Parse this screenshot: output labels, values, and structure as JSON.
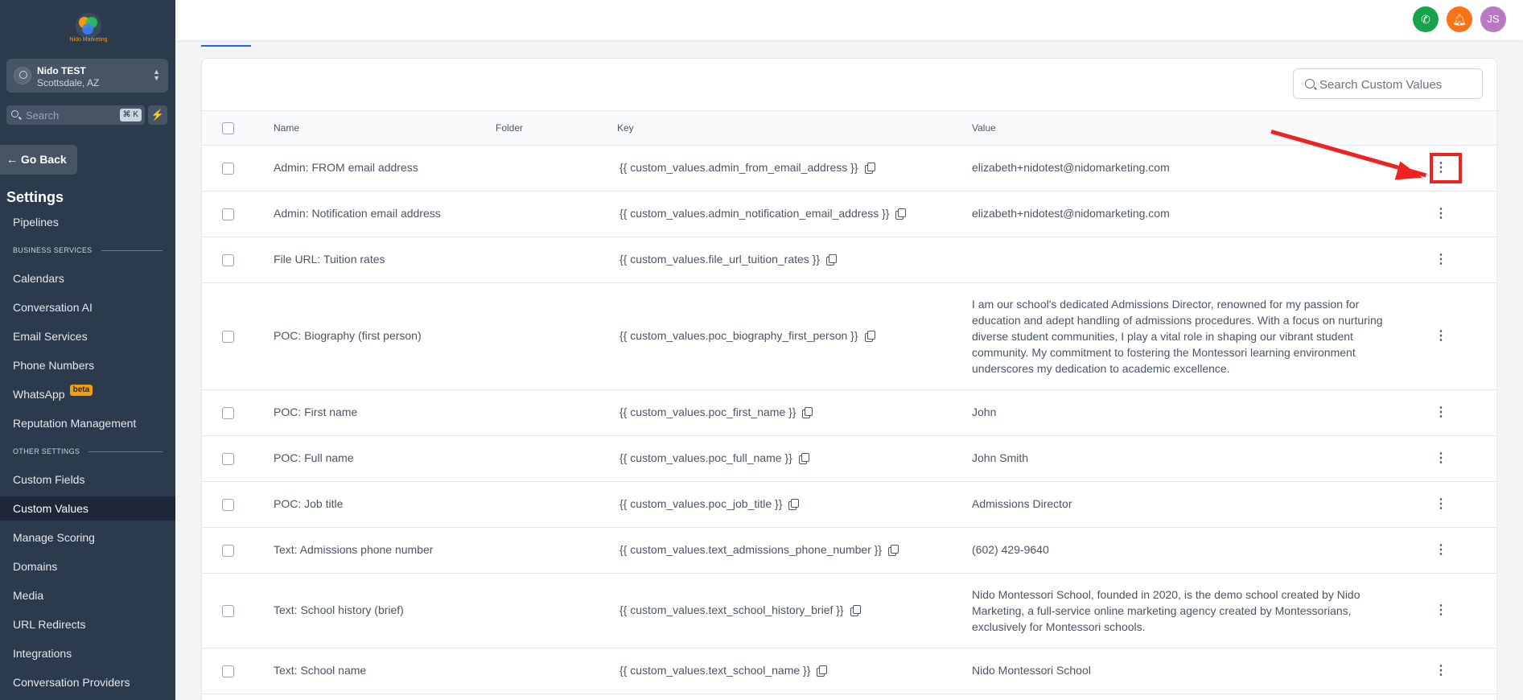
{
  "sidebar": {
    "logo_text": "Nido Marketing",
    "location": {
      "name": "Nido TEST",
      "city": "Scottsdale, AZ"
    },
    "search": {
      "placeholder": "Search",
      "shortcut": "⌘ K"
    },
    "go_back": "Go Back",
    "settings_title": "Settings",
    "pipelines": "Pipelines",
    "section_business": "BUSINESS SERVICES",
    "business_items": [
      "Calendars",
      "Conversation AI",
      "Email Services",
      "Phone Numbers",
      "WhatsApp",
      "Reputation Management"
    ],
    "beta_badge": "beta",
    "section_other": "OTHER SETTINGS",
    "other_items": [
      "Custom Fields",
      "Custom Values",
      "Manage Scoring",
      "Domains",
      "Media",
      "URL Redirects",
      "Integrations",
      "Conversation Providers"
    ],
    "active_item": "Custom Values"
  },
  "topbar": {
    "avatar_initials": "JS",
    "accent_color": "#2563eb"
  },
  "table": {
    "search_placeholder": "Search Custom Values",
    "columns": {
      "name": "Name",
      "folder": "Folder",
      "key": "Key",
      "value": "Value"
    },
    "rows": [
      {
        "name": "Admin: FROM email address",
        "key": "{{ custom_values.admin_from_email_address }}",
        "value": "elizabeth+nidotest@nidomarketing.com"
      },
      {
        "name": "Admin: Notification email address",
        "key": "{{ custom_values.admin_notification_email_address }}",
        "value": "elizabeth+nidotest@nidomarketing.com"
      },
      {
        "name": "File URL: Tuition rates",
        "key": "{{ custom_values.file_url_tuition_rates }}",
        "value": ""
      },
      {
        "name": "POC: Biography (first person)",
        "key": "{{ custom_values.poc_biography_first_person }}",
        "value": "I am our school's dedicated Admissions Director, renowned for my passion for education and adept handling of admissions procedures. With a focus on nurturing diverse student communities, I play a vital role in shaping our vibrant student community. My commitment to fostering the Montessori learning environment underscores my dedication to academic excellence."
      },
      {
        "name": "POC: First name",
        "key": "{{ custom_values.poc_first_name }}",
        "value": "John"
      },
      {
        "name": "POC: Full name",
        "key": "{{ custom_values.poc_full_name }}",
        "value": "John Smith"
      },
      {
        "name": "POC: Job title",
        "key": "{{ custom_values.poc_job_title }}",
        "value": "Admissions Director"
      },
      {
        "name": "Text: Admissions phone number",
        "key": "{{ custom_values.text_admissions_phone_number }}",
        "value": "(602) 429-9640"
      },
      {
        "name": "Text: School history (brief)",
        "key": "{{ custom_values.text_school_history_brief }}",
        "value": "Nido Montessori School, founded in 2020, is the demo school created by Nido Marketing, a full-service online marketing agency created by Montessorians, exclusively for Montessori schools."
      },
      {
        "name": "Text: School name",
        "key": "{{ custom_values.text_school_name }}",
        "value": "Nido Montessori School"
      }
    ]
  },
  "annotation_color": "#ef2222"
}
